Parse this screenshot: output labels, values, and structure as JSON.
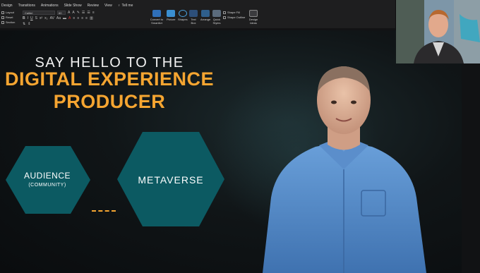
{
  "ribbon": {
    "tabs": [
      "Design",
      "Transitions",
      "Animations",
      "Slide Show",
      "Review",
      "View"
    ],
    "tell_me": "Tell me",
    "slides_group": [
      "Layout",
      "Reset",
      "Section"
    ],
    "font_name": "Calibri",
    "font_size": "60",
    "buttons": {
      "convert": "Convert to SmartArt",
      "picture": "Picture",
      "shapes": "Shapes",
      "text_box": "Text Box",
      "arrange": "Arrange",
      "quick_styles": "Quick Styles",
      "design_ideas": "Design Ideas"
    },
    "shape_fill": "Shape Fill",
    "shape_outline": "Shape Outline"
  },
  "slide": {
    "title_line1": "SAY HELLO TO THE",
    "title_line2": "DIGITAL EXPERIENCE",
    "title_line3": "PRODUCER",
    "hex_small_line1": "AUDIENCE",
    "hex_small_line2": "(COMMUNITY)",
    "hex_big": "METAVERSE"
  },
  "colors": {
    "accent_orange": "#f5a531",
    "hex_teal": "#0c5a62",
    "avatar_shirt": "#4f86c6"
  }
}
